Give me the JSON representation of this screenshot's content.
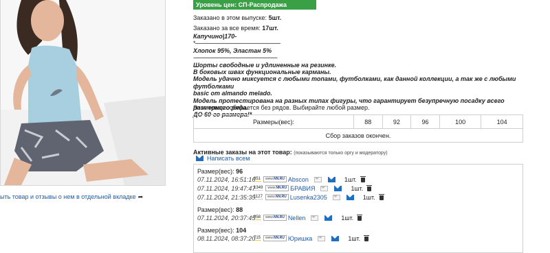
{
  "photo_link": "ыть товар и отзывы о нем в отдельной вкладке",
  "price_level": "Уровень цен: СП-Распродажа",
  "ordered_this": {
    "label": "Заказано в этом выпуске:",
    "value": "5шт."
  },
  "ordered_total": {
    "label": "Заказано за все время:",
    "value": "17шт."
  },
  "desc": {
    "line1": "Капучино|170-",
    "sep1": "*--------------------------------------------------------------",
    "line2": "Хлопок 95%, Эластан 5%",
    "sep2": "-------------------------------------------------------------",
    "body": [
      "Шорты свободные и удлиненные на резинке.",
      "В боковых швах функциональные карманы.",
      "Модель удачно миксуется с любыми топами, футболками, как данной коллекции, а так же с любыми футболками",
      "basic от almando melado.",
      "Модель протестирована на разных типах фигуры, что гарантирует безупречную посадку всего размерного ряда.",
      "ДО 60-го размера!*"
    ]
  },
  "collect_note": "Этот товар собирается без рядов. Выбирайте любой размер.",
  "sizes": {
    "label": "Размеры(вес):",
    "values": [
      "88",
      "92",
      "96",
      "100",
      "104"
    ],
    "closed": "Сбор заказов окончен."
  },
  "orders": {
    "title": "Активные заказы на этот товар:",
    "note": "(показываются только оргу и модератору)",
    "write_all": "Написать всем",
    "size_label": "Размер(вес):",
    "logo_prefix": "www.",
    "logo_mark": "NN.RU",
    "groups": [
      {
        "size": "96",
        "rows": [
          {
            "date": "07.11.2024, 16:51:16",
            "rating": "851",
            "nick": "Abscon",
            "qty": "1шт."
          },
          {
            "date": "07.11.2024, 19:47:47",
            "rating": "1349",
            "nick": "БРАВИЯ",
            "qty": "1шт."
          },
          {
            "date": "07.11.2024, 21:35:35",
            "rating": "1127",
            "nick": "Lusenka2305",
            "qty": "1шт."
          }
        ]
      },
      {
        "size": "88",
        "rows": [
          {
            "date": "07.11.2024, 20:37:45",
            "rating": "858",
            "nick": "Nellen",
            "qty": "1шт."
          }
        ]
      },
      {
        "size": "104",
        "rows": [
          {
            "date": "08.11.2024, 08:37:20",
            "rating": "715",
            "nick": "Юришка",
            "qty": "1шт."
          }
        ]
      }
    ]
  }
}
